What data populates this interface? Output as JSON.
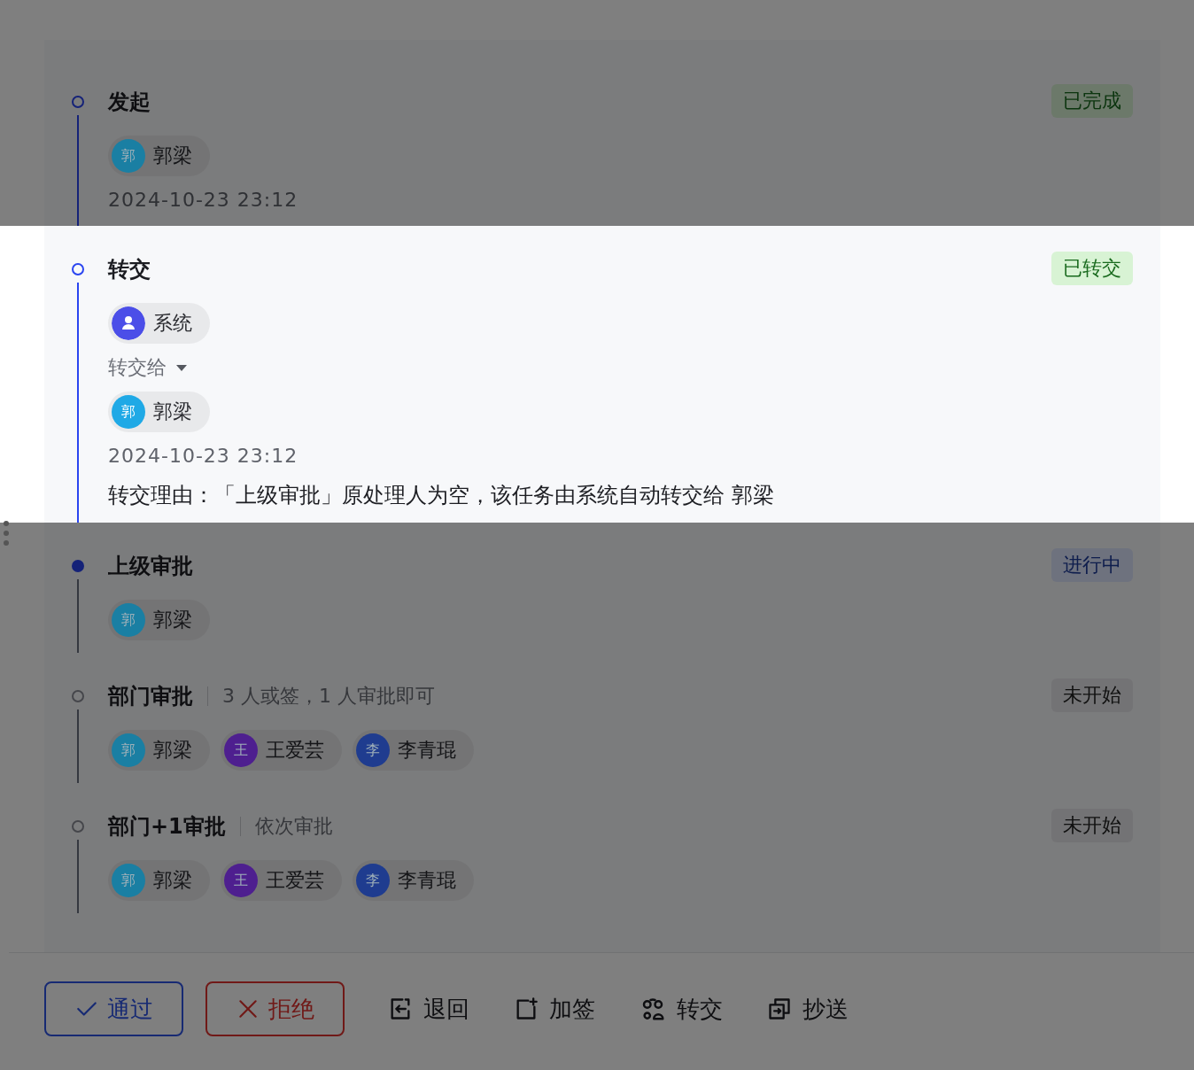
{
  "steps": [
    {
      "title": "发起",
      "kind": "done",
      "status": "已完成",
      "highlighted": false,
      "blocks": [
        {
          "kind": "people",
          "people": [
            {
              "kind": "initial",
              "avatar": "郭",
              "name": "郭梁",
              "color": "#1a7fa3"
            }
          ]
        },
        {
          "kind": "time",
          "text": "2024-10-23 23:12"
        }
      ]
    },
    {
      "title": "转交",
      "kind": "transferred",
      "status": "已转交",
      "highlighted": true,
      "blocks": [
        {
          "kind": "people",
          "people": [
            {
              "kind": "system",
              "name": "系统",
              "color": "#4b4ee8"
            }
          ]
        },
        {
          "kind": "toggle",
          "text": "转交给",
          "expanded": true
        },
        {
          "kind": "people",
          "people": [
            {
              "kind": "initial",
              "avatar": "郭",
              "name": "郭梁",
              "color": "#1fa9e6"
            }
          ]
        },
        {
          "kind": "time",
          "text": "2024-10-23 23:12"
        },
        {
          "kind": "reason",
          "text": "转交理由：「上级审批」原处理人为空，该任务由系统自动转交给 郭梁"
        }
      ]
    },
    {
      "title": "上级审批",
      "kind": "in_progress",
      "status": "进行中",
      "highlighted": false,
      "blocks": [
        {
          "kind": "people",
          "people": [
            {
              "kind": "initial",
              "avatar": "郭",
              "name": "郭梁",
              "color": "#1a7fa3"
            }
          ]
        }
      ]
    },
    {
      "title": "部门审批",
      "mode": "3 人或签，1 人审批即可",
      "kind": "pending",
      "status": "未开始",
      "highlighted": false,
      "blocks": [
        {
          "kind": "people",
          "people": [
            {
              "kind": "initial",
              "avatar": "郭",
              "name": "郭梁",
              "color": "#1a7fa3"
            },
            {
              "kind": "initial",
              "avatar": "王",
              "name": "王爱芸",
              "color": "#4e1f8f"
            },
            {
              "kind": "initial",
              "avatar": "李",
              "name": "李青琨",
              "color": "#1f3c8f"
            }
          ]
        }
      ]
    },
    {
      "title": "部门+1审批",
      "mode": "依次审批",
      "kind": "pending",
      "status": "未开始",
      "highlighted": false,
      "blocks": [
        {
          "kind": "people",
          "people": [
            {
              "kind": "initial",
              "avatar": "郭",
              "name": "郭梁",
              "color": "#1a7fa3"
            },
            {
              "kind": "initial",
              "avatar": "王",
              "name": "王爱芸",
              "color": "#4e1f8f"
            },
            {
              "kind": "initial",
              "avatar": "李",
              "name": "李青琨",
              "color": "#1f3c8f"
            }
          ]
        }
      ]
    }
  ],
  "actions": [
    {
      "kind": "approve",
      "label": "通过"
    },
    {
      "kind": "reject",
      "label": "拒绝"
    },
    {
      "kind": "return",
      "label": "退回"
    },
    {
      "kind": "add_signer",
      "label": "加签"
    },
    {
      "kind": "transfer",
      "label": "转交"
    },
    {
      "kind": "cc",
      "label": "抄送"
    }
  ]
}
